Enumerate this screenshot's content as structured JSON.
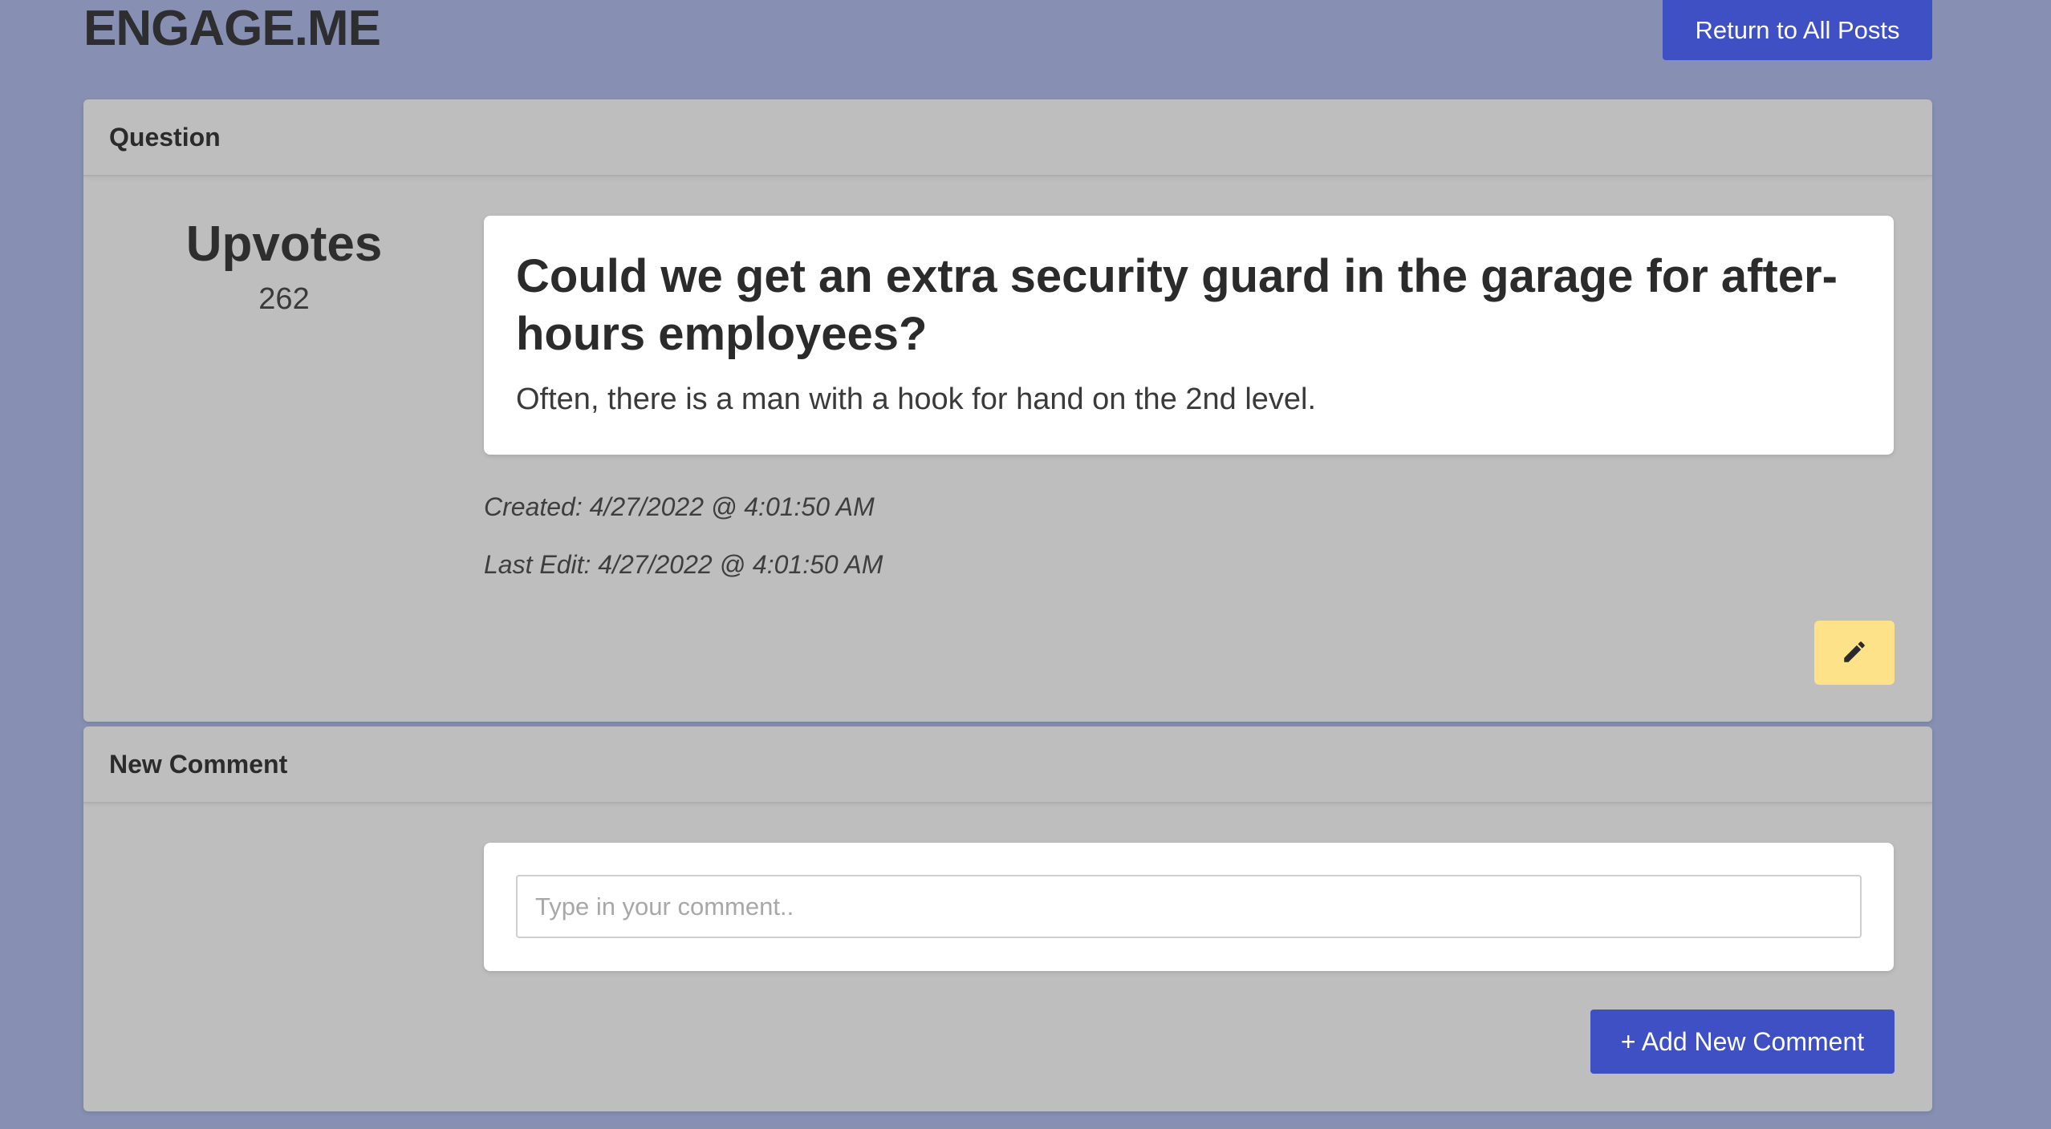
{
  "header": {
    "brand": "ENGAGE.ME",
    "return_label": "Return to All Posts"
  },
  "question_card": {
    "header": "Question",
    "upvotes_label": "Upvotes",
    "upvotes_count": "262",
    "post_title": "Could we get an extra security guard in the garage for after-hours employees?",
    "post_body": "Often, there is a man with a hook for hand on the 2nd level.",
    "created": "Created: 4/27/2022 @ 4:01:50 AM",
    "last_edit": "Last Edit: 4/27/2022 @ 4:01:50 AM",
    "edit_icon": "pencil-icon"
  },
  "comment_card": {
    "header": "New Comment",
    "input_placeholder": "Type in your comment..",
    "add_label": "+ Add New Comment"
  },
  "colors": {
    "background": "#8790b3",
    "card": "#bebebe",
    "primary_button": "#3f4fc4",
    "edit_button": "#fde28a"
  }
}
